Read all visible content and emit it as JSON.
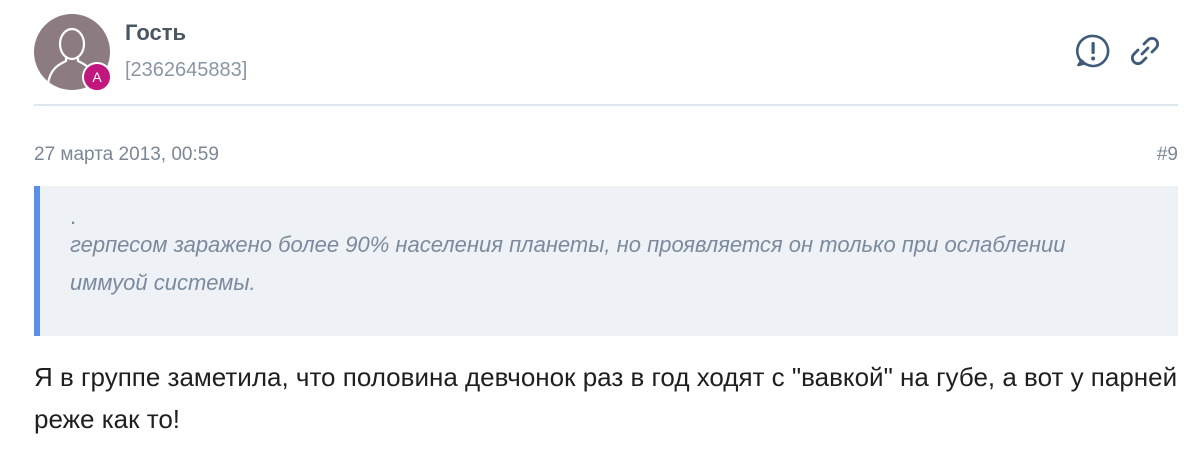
{
  "author": {
    "name": "Гость",
    "id": "[2362645883]",
    "badge": "A",
    "avatar_icon": "user-silhouette-icon",
    "avatar_color": "#8c7b80",
    "badge_color": "#c0167e"
  },
  "actions": {
    "report_icon": "exclamation-circle-icon",
    "link_icon": "link-icon"
  },
  "post": {
    "date": "27 марта 2013, 00:59",
    "number": "#9",
    "quote_marker": ".",
    "quote_text": "герпесом заражено более 90% населения планеты, но проявляется он только при ослаблении иммуой системы.",
    "message": "Я в группе заметила, что половина девчонок раз в год ходят с \"вавкой\" на губе, а вот у парней реже как то!"
  },
  "colors": {
    "quote_border": "#5b8ee6",
    "quote_background": "#eef2f7",
    "icon_color": "#3f5b7a"
  }
}
